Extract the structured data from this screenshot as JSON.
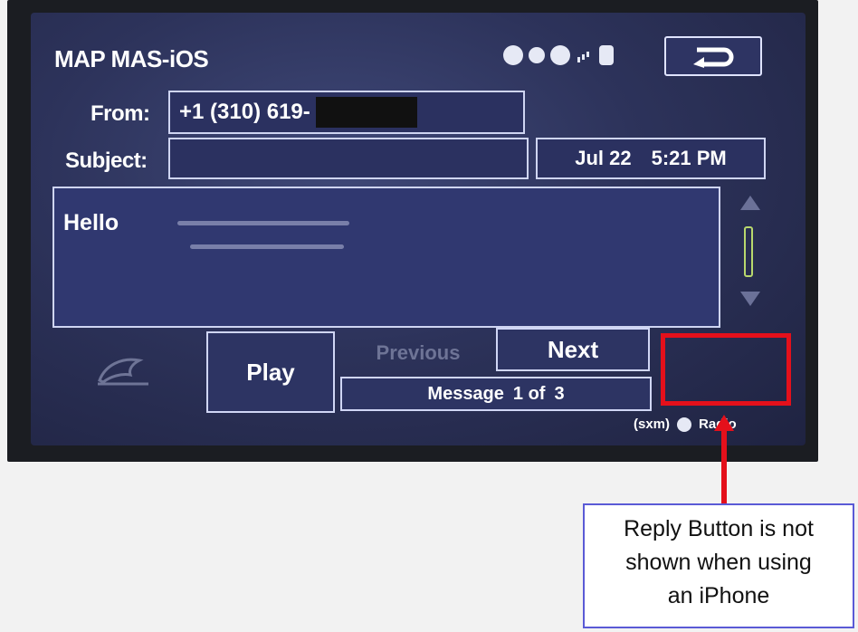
{
  "screen": {
    "title": "MAP MAS-iOS",
    "back_icon": "return-arrow-icon",
    "status_icons": [
      "sirius-icon",
      "mute-icon",
      "bluetooth-icon",
      "signal-bars-icon",
      "battery-icon"
    ]
  },
  "message": {
    "from_label": "From:",
    "from_value": "+1 (310) 619-",
    "subject_label": "Subject:",
    "subject_value": "",
    "date": "Jul 22",
    "time": "5:21 PM",
    "body": "Hello"
  },
  "controls": {
    "play_label": "Play",
    "previous_label": "Previous",
    "next_label": "Next",
    "message_counter_label": "Message",
    "message_counter_value": "1 of",
    "message_counter_total": "3"
  },
  "footer": {
    "sxm_label": "(sxm)",
    "radio_label": "Radio"
  },
  "annotation": {
    "text_lines": [
      "Reply Button is not",
      "shown when using",
      "an iPhone"
    ],
    "color": "#e4101b"
  }
}
